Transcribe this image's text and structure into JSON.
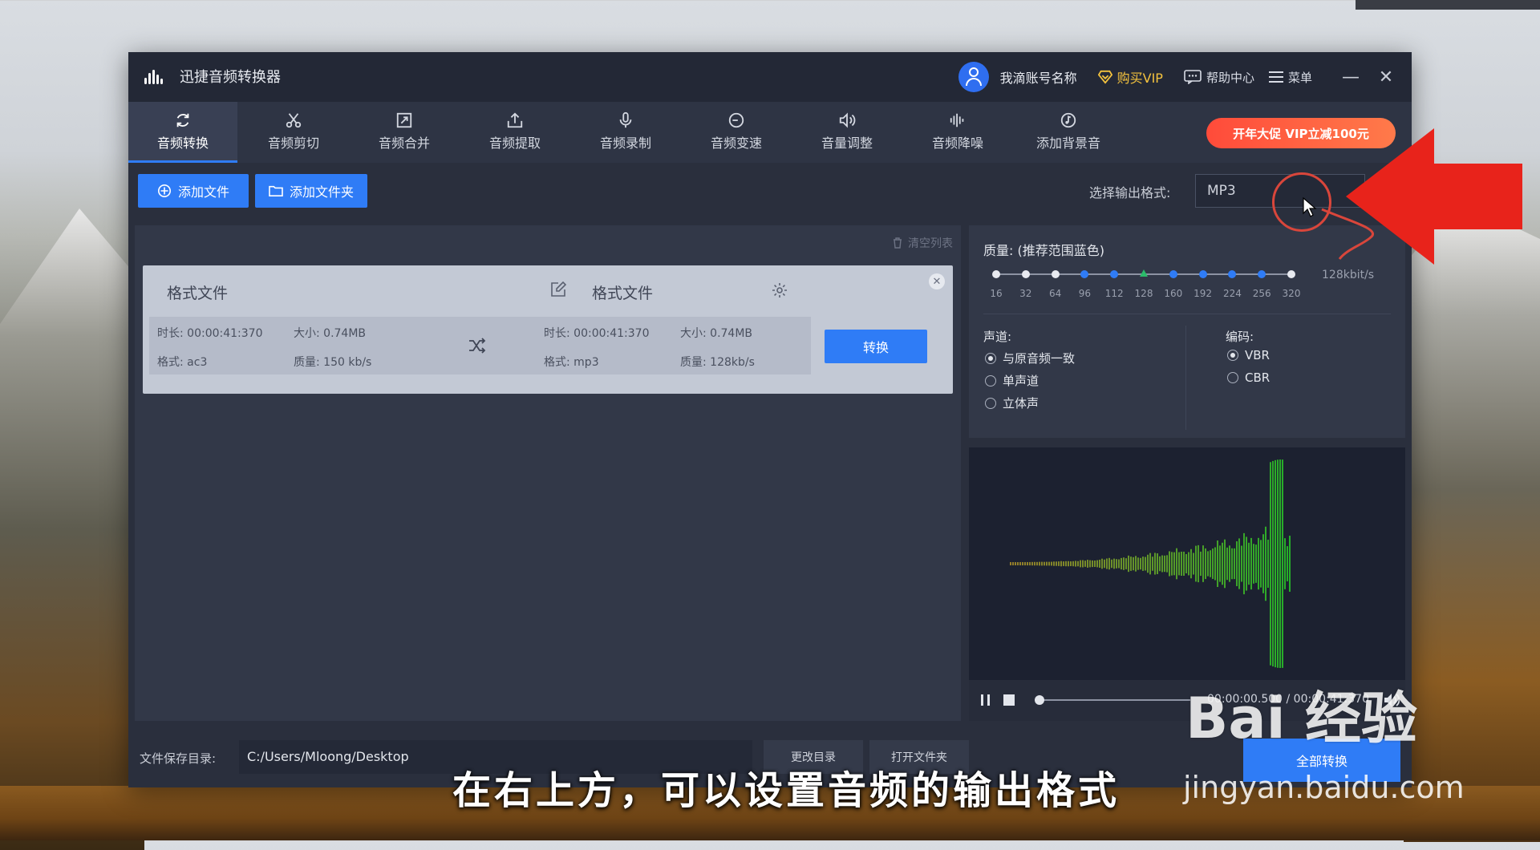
{
  "window": {
    "title": "迅捷音频转换器",
    "account_name": "我滴账号名称",
    "buy_vip": "购买VIP",
    "help": "帮助中心",
    "menu": "菜单",
    "minimize": "—",
    "close": "✕"
  },
  "tabs": [
    {
      "label": "音频转换",
      "icon": "refresh-icon",
      "active": true
    },
    {
      "label": "音频剪切",
      "icon": "scissors-icon"
    },
    {
      "label": "音频合并",
      "icon": "merge-icon"
    },
    {
      "label": "音频提取",
      "icon": "upload-icon"
    },
    {
      "label": "音频录制",
      "icon": "microphone-icon"
    },
    {
      "label": "音频变速",
      "icon": "speed-icon"
    },
    {
      "label": "音量调整",
      "icon": "speaker-icon"
    },
    {
      "label": "音频降噪",
      "icon": "equalizer-icon"
    },
    {
      "label": "添加背景音",
      "icon": "music-icon"
    }
  ],
  "promo": "开年大促 VIP立减100元",
  "actions": {
    "add_file": "添加文件",
    "add_folder": "添加文件夹",
    "output_format_label": "选择输出格式:",
    "output_format_value": "MP3"
  },
  "list": {
    "clear_label": "清空列表",
    "item": {
      "source_name": "格式文件",
      "target_name": "格式文件",
      "source_duration": "时长: 00:00:41:370",
      "source_size": "大小: 0.74MB",
      "source_format": "格式: ac3",
      "source_quality": "质量: 150 kb/s",
      "target_duration": "时长: 00:00:41:370",
      "target_size": "大小: 0.74MB",
      "target_format": "格式: mp3",
      "target_quality": "质量: 128kb/s",
      "convert_label": "转换"
    }
  },
  "settings": {
    "quality_label": "质量: (推荐范围蓝色)",
    "quality_ticks": [
      "16",
      "32",
      "64",
      "96",
      "112",
      "128",
      "160",
      "192",
      "224",
      "256",
      "320"
    ],
    "quality_selected": "128",
    "quality_value_label": "128kbit/s",
    "channel_label": "声道:",
    "channel_options": [
      "与原音频一致",
      "单声道",
      "立体声"
    ],
    "channel_selected": 0,
    "encoding_label": "编码:",
    "encoding_options": [
      "VBR",
      "CBR"
    ],
    "encoding_selected": 0
  },
  "player": {
    "time_display": "00:00:00.500 / 00:00:41:370",
    "progress": 0.01
  },
  "footer": {
    "save_dir_label": "文件保存目录:",
    "save_dir_path": "C:/Users/Mloong/Desktop",
    "change_dir": "更改目录",
    "open_folder": "打开文件夹",
    "convert_all": "全部转换"
  },
  "overlay": {
    "subtitle": "在右上方，可以设置音频的输出格式",
    "watermark_brand": "Bai 经验",
    "watermark_url": "jingyan.baidu.com"
  },
  "colors": {
    "accent": "#2f7cf6",
    "vip": "#f3c23e",
    "promo": "#ff4b3a",
    "annotation": "#e8231b"
  }
}
